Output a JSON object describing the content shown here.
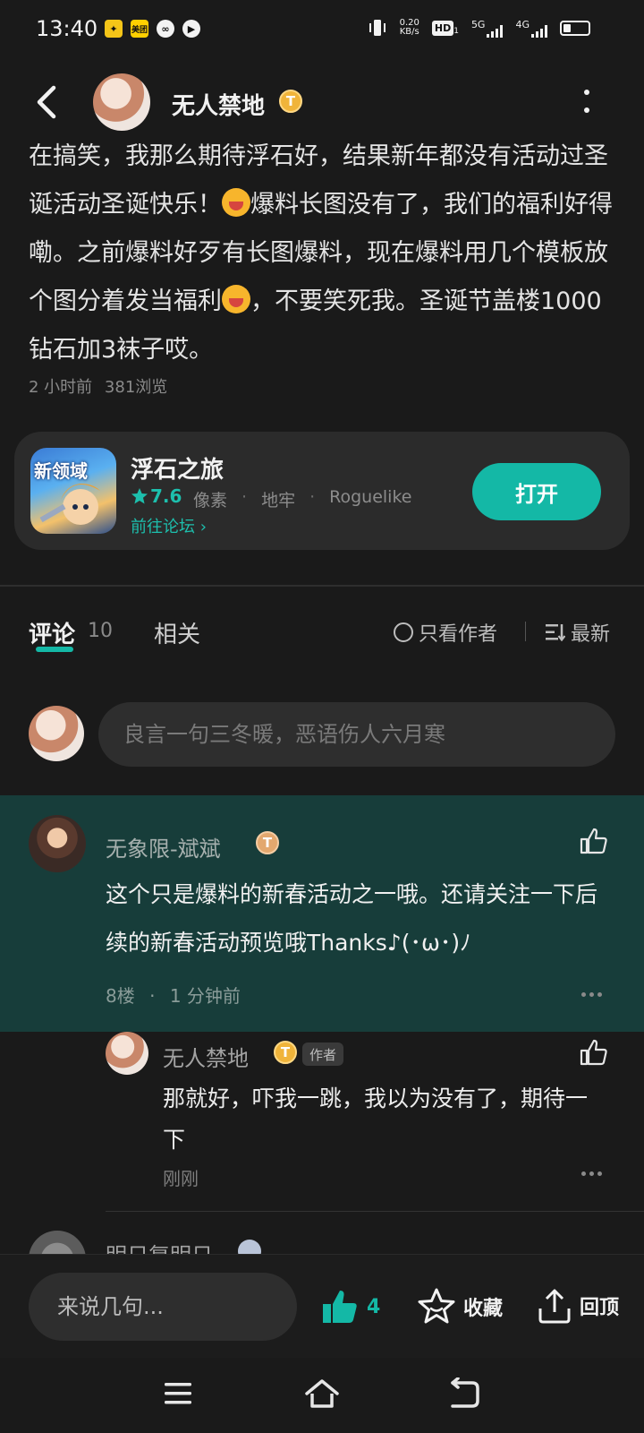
{
  "status_bar": {
    "time": "13:40",
    "app_icons": [
      "notification-app-icon",
      "meituan-icon",
      "link-app-icon",
      "play-app-icon"
    ],
    "meituan_label": "美团",
    "net_speed_value": "0.20",
    "net_speed_unit": "KB/s",
    "hd_label": "HD",
    "hd_sub": "1",
    "net1": "5G",
    "net2": "4G"
  },
  "header": {
    "back_icon": "chevron-left-icon",
    "author_name": "无人禁地",
    "author_badge": "T",
    "more_icon": "more-vertical-icon"
  },
  "post": {
    "text_part1": "在搞笑，我那么期待浮石好，结果新年都没有活动过圣诞活动圣诞快乐！",
    "text_part2": "爆料长图没有了，我们的福利好得嘞。之前爆料好歹有长图爆料，现在爆料用几个模板放个图分着发当福利",
    "text_part3": "，不要笑死我。圣诞节盖楼1000钻石加3袜子哎。",
    "time": "2 小时前",
    "views": "381浏览"
  },
  "game_card": {
    "icon_text": "新领域",
    "name": "浮石之旅",
    "rating": "7.6",
    "tags": [
      "像素",
      "地牢",
      "Roguelike"
    ],
    "forum_link": "前往论坛",
    "open_button": "打开"
  },
  "tabs": {
    "comments_label": "评论",
    "comments_count": "10",
    "related_label": "相关",
    "author_only": "只看作者",
    "sort": "最新"
  },
  "comment_input": {
    "placeholder": "良言一句三冬暖，恶语伤人六月寒"
  },
  "comments": [
    {
      "name": "无象限-斌斌",
      "badge": "T",
      "text": "这个只是爆料的新春活动之一哦。还请关注一下后续的新春活动预览哦Thanks♪(･ω･)ﾉ",
      "floor": "8楼",
      "time": "1 分钟前",
      "reply": {
        "name": "无人禁地",
        "badge": "T",
        "author_tag": "作者",
        "text": "那就好，吓我一跳，我以为没有了，期待一下",
        "time": "刚刚"
      }
    },
    {
      "name": "明日复明日"
    }
  ],
  "action_bar": {
    "input_placeholder": "来说几句...",
    "like_count": "4",
    "favorite_label": "收藏",
    "back_to_top_label": "回顶"
  },
  "colors": {
    "accent": "#14b8a6",
    "background": "#1a1a1a",
    "highlight_comment_bg": "#173d3a",
    "badge_gold": "#f0b43a"
  }
}
